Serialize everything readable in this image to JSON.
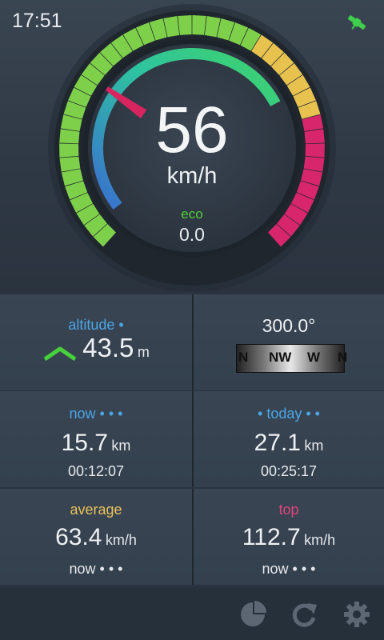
{
  "status": {
    "time": "17:51",
    "gps_icon": "satellite-icon"
  },
  "speedometer": {
    "speed": "56",
    "unit": "km/h",
    "eco_label": "eco",
    "eco_value": "0.0"
  },
  "altitude": {
    "label": "altitude •",
    "value": "43.5",
    "unit": "m",
    "trend": "up"
  },
  "heading": {
    "degrees": "300.0°",
    "strip": [
      "N",
      "NW",
      "W",
      "N"
    ]
  },
  "trip_now": {
    "label": "now • • •",
    "distance": "15.7",
    "unit": "km",
    "time": "00:12:07"
  },
  "trip_today": {
    "label": "• today • •",
    "distance": "27.1",
    "unit": "km",
    "time": "00:25:17"
  },
  "average": {
    "label": "average",
    "value": "63.4",
    "unit": "km/h",
    "scope": "now • • •"
  },
  "top": {
    "label": "top",
    "value": "112.7",
    "unit": "km/h",
    "scope": "now • • •"
  },
  "toolbar": {
    "icons": [
      "pie-chart-icon",
      "refresh-icon",
      "gear-icon"
    ]
  },
  "colors": {
    "green": "#7ed04a",
    "yellow": "#e7c24f",
    "pink": "#d7266b",
    "blue": "#4aa6e6",
    "arc_start": "#3a6fd0",
    "arc_end": "#3fd36a"
  }
}
